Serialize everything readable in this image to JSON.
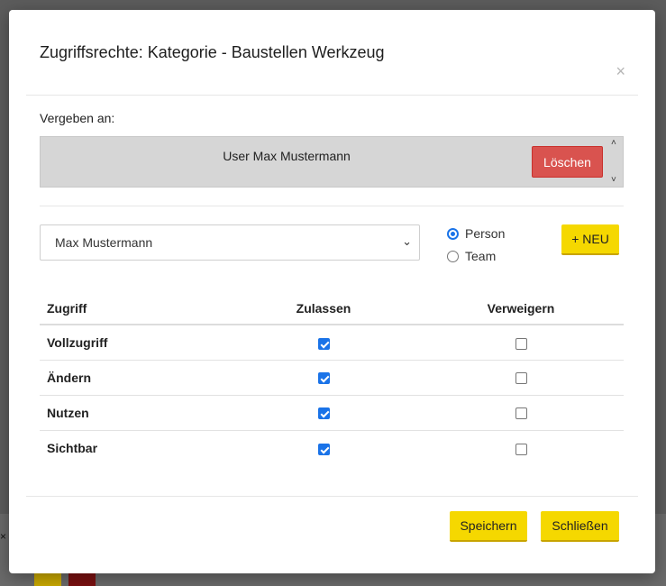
{
  "background": {
    "close_glyph": "×"
  },
  "modal": {
    "title": "Zugriffsrechte: Kategorie - Baustellen Werkzeug",
    "close_glyph": "×",
    "assigned_label": "Vergeben an:",
    "assigned_entry": "User Max Mustermann",
    "delete_label": "Löschen",
    "scroll_up_glyph": "˄",
    "scroll_down_glyph": "˅",
    "select": {
      "value": "Max Mustermann",
      "caret": "⌄"
    },
    "radios": [
      {
        "label": "Person",
        "checked": true
      },
      {
        "label": "Team",
        "checked": false
      }
    ],
    "new_label": "+ NEU",
    "table": {
      "headers": [
        "Zugriff",
        "Zulassen",
        "Verweigern"
      ],
      "rows": [
        {
          "name": "Vollzugriff",
          "allow": true,
          "deny": false
        },
        {
          "name": "Ändern",
          "allow": true,
          "deny": false
        },
        {
          "name": "Nutzen",
          "allow": true,
          "deny": false
        },
        {
          "name": "Sichtbar",
          "allow": true,
          "deny": false
        }
      ]
    },
    "footer": {
      "save_label": "Speichern",
      "close_label": "Schließen"
    }
  },
  "colors": {
    "accent_yellow": "#f5d800",
    "danger_red": "#d9534f",
    "checkbox_blue": "#1a73e8"
  }
}
